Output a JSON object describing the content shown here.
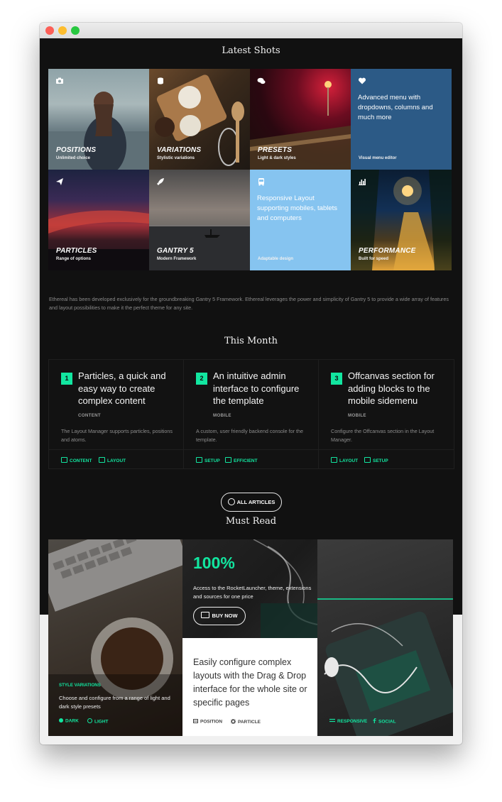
{
  "sections": {
    "latest_shots": "Latest Shots",
    "this_month": "This Month",
    "must_read": "Must Read"
  },
  "tiles": [
    {
      "icon": "camera-icon",
      "title": "POSITIONS",
      "subtitle": "Unlimited choice"
    },
    {
      "icon": "database-icon",
      "title": "VARIATIONS",
      "subtitle": "Stylistic variations"
    },
    {
      "icon": "comments-icon",
      "title": "PRESETS",
      "subtitle": "Light & dark styles"
    },
    {
      "icon": "heart-icon",
      "text": "Advanced menu with dropdowns, columns and much more",
      "subtitle": "Visual menu editor"
    },
    {
      "icon": "paper-plane-icon",
      "title": "PARTICLES",
      "subtitle": "Range of options"
    },
    {
      "icon": "rocket-icon",
      "title": "GANTRY 5",
      "subtitle": "Modern Framework"
    },
    {
      "icon": "bus-icon",
      "text": "Responsive Layout supporting mobiles, tablets and computers",
      "subtitle": "Adaptable design"
    },
    {
      "icon": "bar-chart-icon",
      "title": "PERFORMANCE",
      "subtitle": "Built for speed"
    }
  ],
  "intro": "Ethereal has been developed exclusively for the groundbreaking Gantry 5 Framework. Ethereal leverages the power and simplicity of Gantry 5 to provide a wide array of features and layout possibilities to make it the perfect theme for any site.",
  "cards": [
    {
      "num": "1",
      "title": "Particles, a quick and easy way to create complex content",
      "category": "CONTENT",
      "desc": "The Layout Manager supports particles, positions and atoms.",
      "tags": [
        "CONTENT",
        "LAYOUT"
      ]
    },
    {
      "num": "2",
      "title": "An intuitive admin interface to configure the template",
      "category": "MOBILE",
      "desc": "A custom, user friendly backend console for the template.",
      "tags": [
        "SETUP",
        "EFFICIENT"
      ]
    },
    {
      "num": "3",
      "title": "Offcanvas section for adding blocks to the mobile sidemenu",
      "category": "MOBILE",
      "desc": "Configure the Offcanvas section in the Layout Manager.",
      "tags": [
        "LAYOUT",
        "SETUP"
      ]
    }
  ],
  "all_articles": "ALL ARTICLES",
  "must_read": {
    "style": {
      "label": "STYLE VARIATIONS",
      "text": "Choose and configure from a range of light and dark style presets",
      "tags": [
        "DARK",
        "LIGHT"
      ]
    },
    "promo": {
      "percent": "100%",
      "text": "Access to the RocketLauncher, theme, extensions and sources for one price",
      "button": "BUY NOW"
    },
    "feature": {
      "text": "Easily configure complex layouts with the Drag & Drop interface for the whole site or specific pages",
      "tags": [
        "POSITION",
        "PARTICLE"
      ]
    },
    "right": {
      "tags": [
        "RESPONSIVE",
        "SOCIAL"
      ]
    }
  },
  "colors": {
    "accent": "#12e6a0",
    "dark_bg": "#111111",
    "blue_tile": "#2c5a86",
    "light_blue_tile": "#86c4f0"
  }
}
